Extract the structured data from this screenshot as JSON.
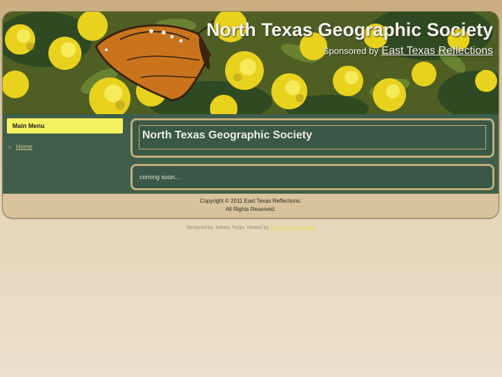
{
  "header": {
    "site_title": "North Texas Geographic Society",
    "sponsor_label": "Sponsored by",
    "sponsor_link": "East Texas Reflections"
  },
  "sidebar": {
    "heading": "Main Menu",
    "items": [
      {
        "label": "Home"
      }
    ]
  },
  "main": {
    "title": "North Texas Geographic Society",
    "body": "coming soon..."
  },
  "footer": {
    "copyright": "Copyright © 2011 East Texas Reflections.",
    "rights": "All Rights Reserved."
  },
  "credits": {
    "designed_by": "Designed by Johnny Taylor. Hosted by",
    "host_link": "Yvonne Ann Hawkins"
  },
  "colors": {
    "page_bg": "#e5d6bb",
    "content_green": "#3f5e4b",
    "border_tan": "#c5ad7a",
    "menu_yellow": "#f5f160"
  },
  "icons": {
    "menu_bullet": "double-chevron-right-icon"
  }
}
